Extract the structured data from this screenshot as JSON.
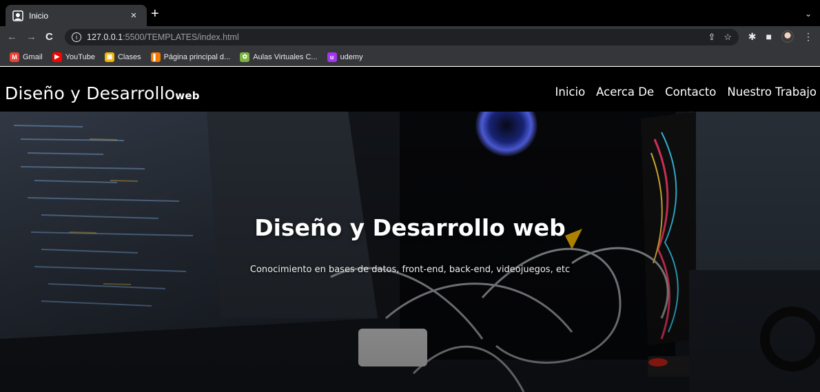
{
  "browser": {
    "tab": {
      "title": "Inicio",
      "close": "×"
    },
    "new_tab": "+",
    "tab_menu": "⌄",
    "nav": {
      "back": "←",
      "forward": "→",
      "reload": "C"
    },
    "address": {
      "host": "127.0.0.1",
      "path": ":5500/TEMPLATES/index.html"
    },
    "address_icons": [
      "share-icon",
      "star-icon"
    ],
    "toolbar_icons": [
      "extensions-icon",
      "sidebar-icon",
      "profile-avatar",
      "kebab-menu-icon"
    ],
    "bookmarks": [
      {
        "label": "Gmail",
        "icon": "gmail-icon",
        "color": "#ea4335",
        "glyph": "M"
      },
      {
        "label": "YouTube",
        "icon": "youtube-icon",
        "color": "#ff0000",
        "glyph": "▶"
      },
      {
        "label": "Clases",
        "icon": "classroom-icon",
        "color": "#f4b400",
        "glyph": "▣"
      },
      {
        "label": "Página principal d...",
        "icon": "bookmark-orange-icon",
        "color": "#f57c00",
        "glyph": "▌"
      },
      {
        "label": "Aulas Virtuales C...",
        "icon": "bookmark-leaf-icon",
        "color": "#7cb342",
        "glyph": "✿"
      },
      {
        "label": "udemy",
        "icon": "udemy-icon",
        "color": "#a435f0",
        "glyph": "u"
      }
    ]
  },
  "site": {
    "brand": {
      "main": "Diseño y Desarrollo",
      "sub": "web"
    },
    "nav": [
      "Inicio",
      "Acerca De",
      "Contacto",
      "Nuestro Trabajo"
    ],
    "hero": {
      "title": "Diseño y Desarrollo web",
      "subtitle": "Conocimiento en bases de datos, front-end, back-end, videojuegos, etc"
    }
  }
}
